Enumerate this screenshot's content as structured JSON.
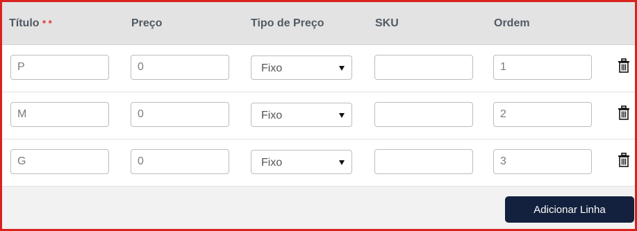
{
  "table": {
    "headers": {
      "titulo": "Título",
      "titulo_required_marker": "* *",
      "preco": "Preço",
      "tipo_de_preco": "Tipo de Preço",
      "sku": "SKU",
      "ordem": "Ordem"
    },
    "rows": [
      {
        "titulo": "P",
        "preco": "0",
        "tipo_de_preco": "Fixo",
        "sku": "",
        "ordem": "1"
      },
      {
        "titulo": "M",
        "preco": "0",
        "tipo_de_preco": "Fixo",
        "sku": "",
        "ordem": "2"
      },
      {
        "titulo": "G",
        "preco": "0",
        "tipo_de_preco": "Fixo",
        "sku": "",
        "ordem": "3"
      }
    ]
  },
  "footer": {
    "add_row_label": "Adicionar Linha"
  },
  "icons": {
    "delete_row": "trash-icon"
  },
  "colors": {
    "frame_border": "#d9211d",
    "header_bg": "#e3e3e3",
    "button_bg": "#13213e",
    "required_marker": "#e03030"
  }
}
